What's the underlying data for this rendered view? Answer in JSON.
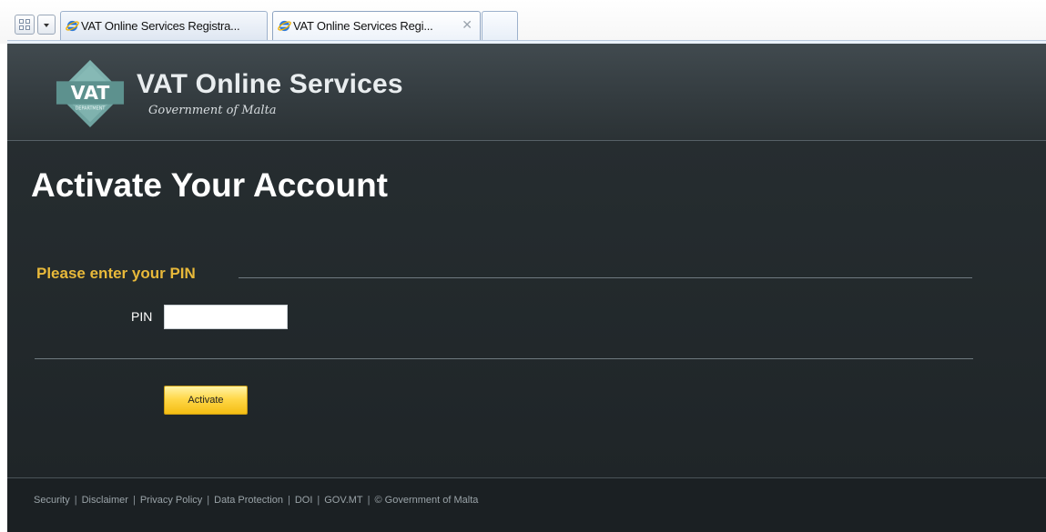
{
  "browser": {
    "tabs": [
      {
        "label": "VAT Online Services Registra...",
        "active": false
      },
      {
        "label": "VAT Online Services Regi...",
        "active": true
      }
    ],
    "close_symbol": "✕",
    "icons": {
      "quick_tabs": "quick-tabs-icon",
      "tab_list": "chevron-down-icon",
      "tab_favicon": "internet-explorer-icon"
    }
  },
  "header": {
    "logo_text": "VAT",
    "logo_subtext": "DEPARTMENT",
    "site_title": "VAT Online Services",
    "site_subtitle": "Government of Malta"
  },
  "main": {
    "page_title": "Activate Your Account",
    "section_legend": "Please enter your PIN",
    "pin_label": "PIN",
    "pin_value": "",
    "activate_label": "Activate"
  },
  "footer": {
    "links": [
      "Security",
      "Disclaimer",
      "Privacy Policy",
      "Data Protection",
      "DOI",
      "GOV.MT"
    ],
    "separator": "|",
    "copyright": "© Government of Malta"
  },
  "colors": {
    "page_background": "#232a2d",
    "header_background": "#3a4246",
    "accent_yellow": "#e8b93a",
    "button_yellow": "#ffd84a",
    "logo_teal": "#6fa3a0"
  }
}
